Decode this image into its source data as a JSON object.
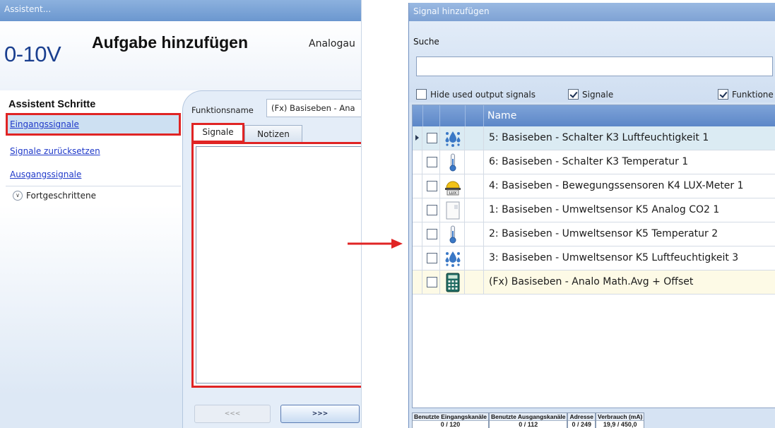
{
  "wizard": {
    "title": "Assistent...",
    "logo": "0-10V",
    "heading": "Aufgabe hinzufügen",
    "heading_sub": "Analogau",
    "steps_title": "Assistent Schritte",
    "steps": [
      {
        "label": "Eingangssignale",
        "active": true
      },
      {
        "label": "Signale zurücksetzen",
        "active": false
      },
      {
        "label": "Ausgangssignale",
        "active": false
      }
    ],
    "advanced_label": "Fortgeschrittene",
    "function_label": "Funktionsname",
    "function_value": "(Fx) Basiseben - Ana",
    "tabs": [
      {
        "label": "Signale",
        "selected": true
      },
      {
        "label": "Notizen",
        "selected": false
      }
    ],
    "prev_label": "<<<",
    "next_label": ">>>"
  },
  "dialog": {
    "title": "Signal hinzufügen",
    "search_label": "Suche",
    "search_value": "",
    "filters": [
      {
        "label": "Hide used output signals",
        "checked": false
      },
      {
        "label": "Signale",
        "checked": true
      },
      {
        "label": "Funktione",
        "checked": true
      }
    ],
    "column_name": "Name",
    "rows": [
      {
        "name": "5: Basiseben - Schalter K3 Luftfeuchtigkeit 1",
        "icon": "humidity-icon",
        "current": true
      },
      {
        "name": "6: Basiseben - Schalter K3 Temperatur 1",
        "icon": "thermometer-icon"
      },
      {
        "name": "4: Basiseben - Bewegungssensoren K4 LUX-Meter 1",
        "icon": "lux-meter-icon"
      },
      {
        "name": "1: Basiseben - Umweltsensor K5 Analog CO2 1",
        "icon": "analog-sensor-icon"
      },
      {
        "name": "2: Basiseben - Umweltsensor K5 Temperatur 2",
        "icon": "thermometer-icon"
      },
      {
        "name": "3: Basiseben - Umweltsensor K5 Luftfeuchtigkeit 3",
        "icon": "humidity-icon"
      },
      {
        "name": "(Fx) Basiseben - Analo Math.Avg + Offset",
        "icon": "calculator-icon",
        "fx": true
      }
    ],
    "status": [
      {
        "header": "Benutzte Eingangskanäle",
        "value": "0 / 120"
      },
      {
        "header": "Benutzte Ausgangskanäle",
        "value": "0 / 112"
      },
      {
        "header": "Adresse",
        "value": "0 / 249"
      },
      {
        "header": "Verbrauch (mA)",
        "value": "19,9 / 450,0"
      }
    ]
  },
  "colors": {
    "highlight": "#e02424",
    "title_bar": "#7ea2d4",
    "logo": "#1a3f8f",
    "link": "#1f39c9"
  }
}
